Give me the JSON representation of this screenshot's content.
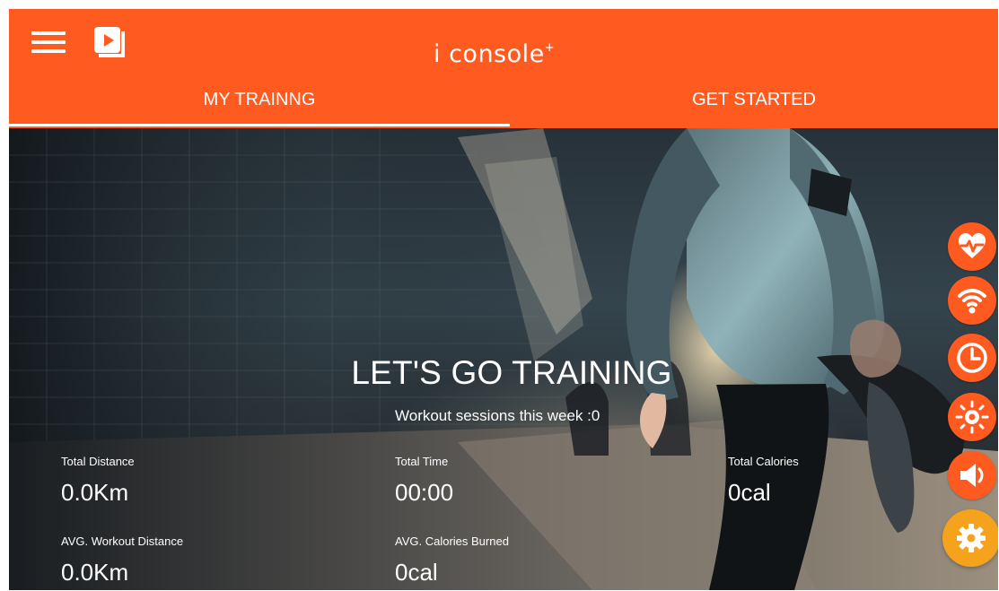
{
  "header": {
    "logo_text": "i console",
    "logo_mark": "+",
    "background_color": "#ff5a1f"
  },
  "tabs": [
    {
      "label": "MY TRAINNG",
      "active": true
    },
    {
      "label": "GET STARTED",
      "active": false
    }
  ],
  "icons": {
    "menu": "hamburger-menu-icon",
    "video": "video-play-icon",
    "heart_rate": "heart-rate-icon",
    "wifi": "wifi-icon",
    "timer": "timer-icon",
    "brightness": "brightness-icon",
    "volume": "volume-icon",
    "settings": "gear-icon"
  },
  "hero": {
    "title": "LET'S GO TRAINING",
    "sessions_label": "Workout sessions this week :0"
  },
  "stats": {
    "total_distance": {
      "label": "Total Distance",
      "value": "0.0Km"
    },
    "total_time": {
      "label": "Total Time",
      "value": "00:00"
    },
    "total_calories": {
      "label": "Total Calories",
      "value": "0cal"
    },
    "avg_workout_distance": {
      "label": "AVG. Workout Distance",
      "value": "0.0Km"
    },
    "avg_calories_burned": {
      "label": "AVG. Calories Burned",
      "value": "0cal"
    }
  },
  "colors": {
    "orange": "#ff5a1f",
    "settings_orange": "#f5a21c",
    "text": "#ffffff"
  }
}
